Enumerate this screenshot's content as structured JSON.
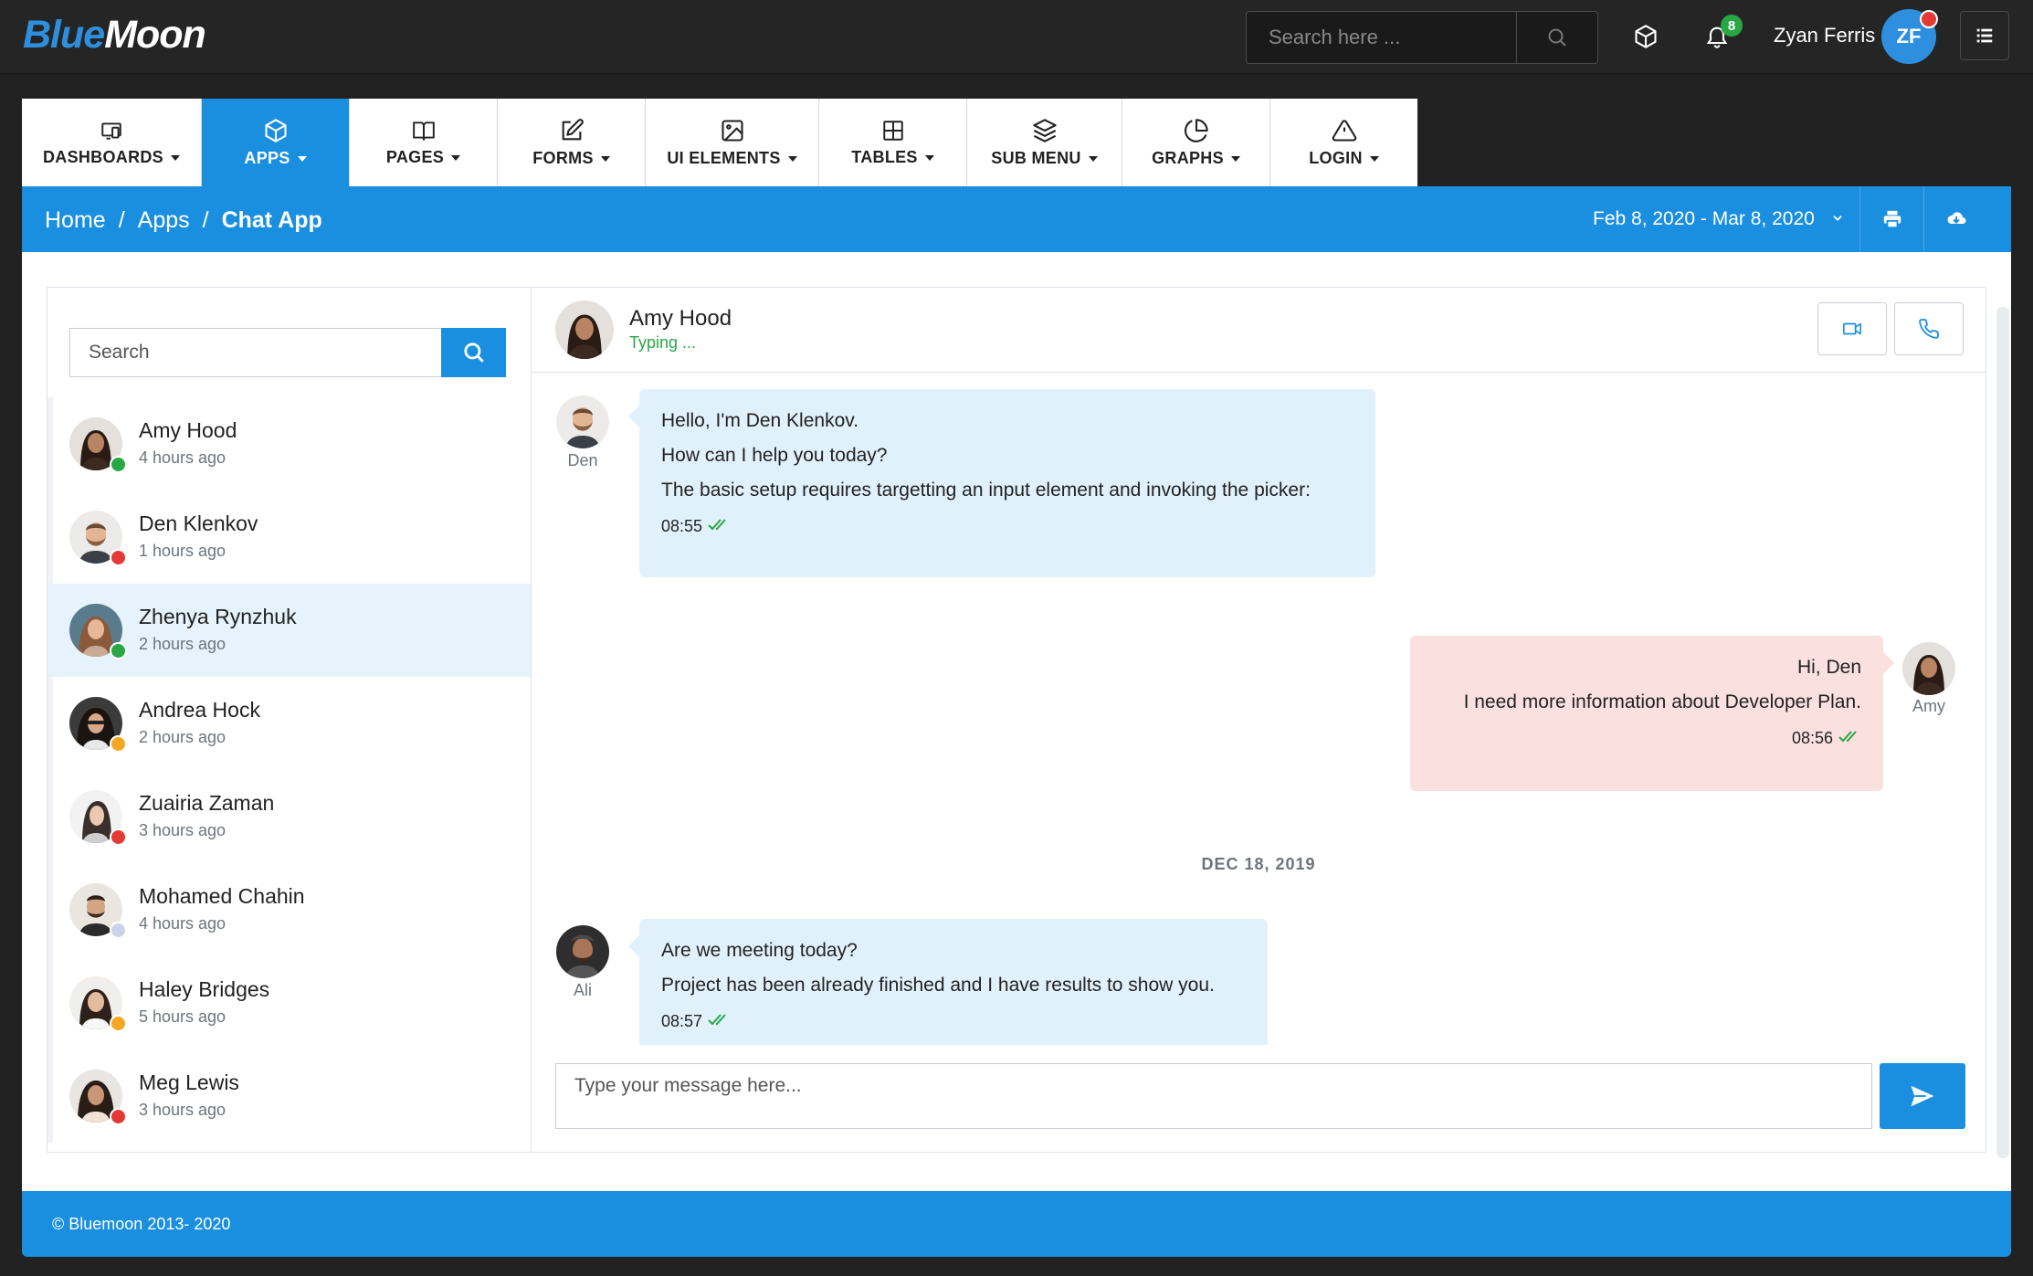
{
  "brand": {
    "part1": "Blue",
    "part2": "Moon"
  },
  "topbar": {
    "search_placeholder": "Search here ...",
    "notification_count": "8",
    "user_name": "Zyan Ferris",
    "user_initials": "ZF"
  },
  "nav": [
    {
      "label": "DASHBOARDS",
      "icon": "dashboard-icon"
    },
    {
      "label": "APPS",
      "icon": "box-icon",
      "active": true
    },
    {
      "label": "PAGES",
      "icon": "book-icon"
    },
    {
      "label": "FORMS",
      "icon": "edit-icon"
    },
    {
      "label": "UI ELEMENTS",
      "icon": "image-icon"
    },
    {
      "label": "TABLES",
      "icon": "grid-icon"
    },
    {
      "label": "SUB MENU",
      "icon": "layers-icon"
    },
    {
      "label": "GRAPHS",
      "icon": "pie-chart-icon"
    },
    {
      "label": "LOGIN",
      "icon": "warning-icon"
    }
  ],
  "breadcrumb": {
    "home": "Home",
    "apps": "Apps",
    "current": "Chat App",
    "sep": "/"
  },
  "date_range": "Feb 8, 2020 - Mar 8, 2020",
  "sidebar": {
    "search_placeholder": "Search",
    "contacts": [
      {
        "name": "Amy Hood",
        "time": "4 hours ago",
        "status_color": "#28a745"
      },
      {
        "name": "Den Klenkov",
        "time": "1 hours ago",
        "status_color": "#e53935"
      },
      {
        "name": "Zhenya Rynzhuk",
        "time": "2 hours ago",
        "status_color": "#28a745"
      },
      {
        "name": "Andrea Hock",
        "time": "2 hours ago",
        "status_color": "#f5a623"
      },
      {
        "name": "Zuairia Zaman",
        "time": "3 hours ago",
        "status_color": "#e53935"
      },
      {
        "name": "Mohamed Chahin",
        "time": "4 hours ago",
        "status_color": "#c9d3e8"
      },
      {
        "name": "Haley Bridges",
        "time": "5 hours ago",
        "status_color": "#f5a623"
      },
      {
        "name": "Meg Lewis",
        "time": "3 hours ago",
        "status_color": "#e53935"
      }
    ]
  },
  "conversation": {
    "name": "Amy Hood",
    "status": "Typing ...",
    "messages": [
      {
        "sender": "Den",
        "lines": [
          "Hello, I'm Den Klenkov.",
          "How can I help you today?",
          "The basic setup requires targetting an input element and invoking the picker:"
        ],
        "time": "08:55"
      },
      {
        "sender": "Amy",
        "lines": [
          "Hi, Den",
          "I need more information about Developer Plan."
        ],
        "time": "08:56"
      },
      {
        "sender": "Ali",
        "lines": [
          "Are we meeting today?",
          "Project has been already finished and I have results to show you."
        ],
        "time": "08:57"
      }
    ],
    "date_separator": "DEC 18, 2019",
    "composer_placeholder": "Type your message here..."
  },
  "footer": {
    "text": "© Bluemoon 2013- 2020"
  },
  "colors": {
    "primary": "#1a8fe0",
    "incoming": "#e1f1fc",
    "outgoing": "#fbe0e0",
    "online": "#28a745"
  }
}
